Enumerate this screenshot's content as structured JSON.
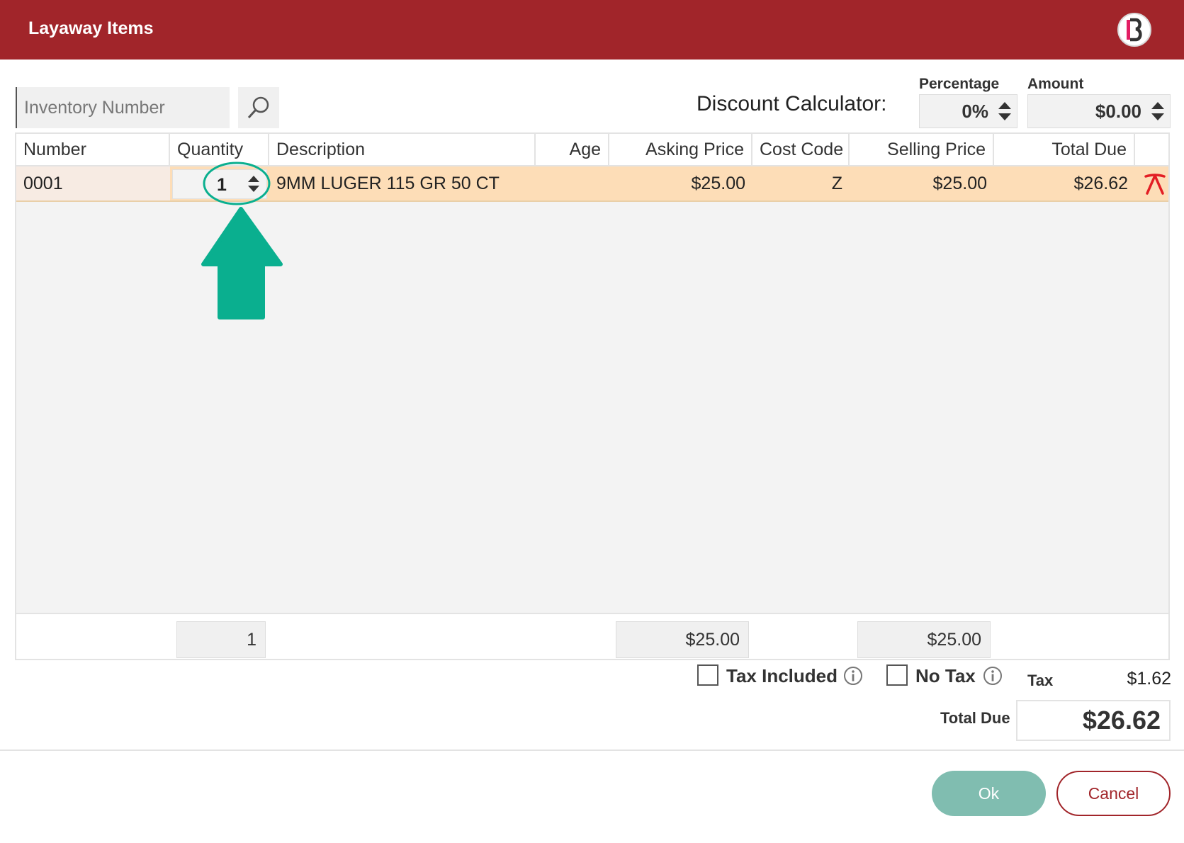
{
  "window": {
    "title": "Layaway Items"
  },
  "search": {
    "placeholder": "Inventory Number",
    "value": ""
  },
  "discount": {
    "label": "Discount Calculator:",
    "percentage_caption": "Percentage",
    "percentage_value": "0%",
    "amount_caption": "Amount",
    "amount_value": "$0.00"
  },
  "table": {
    "headers": [
      "Number",
      "Quantity",
      "Description",
      "Age",
      "Asking Price",
      "Cost Code",
      "Selling Price",
      "Total Due"
    ],
    "rows": [
      {
        "number": "0001",
        "quantity": "1",
        "description": "9MM LUGER 115 GR 50 CT",
        "age": "",
        "asking_price": "$25.00",
        "cost_code": "Z",
        "selling_price": "$25.00",
        "total_due": "$26.62"
      }
    ]
  },
  "totals": {
    "quantity": "1",
    "asking_price": "$25.00",
    "selling_price": "$25.00"
  },
  "tax": {
    "tax_included_label": "Tax Included",
    "no_tax_label": "No Tax",
    "tax_label": "Tax",
    "tax_value": "$1.62",
    "total_due_label": "Total Due",
    "total_due_value": "$26.62"
  },
  "buttons": {
    "ok": "Ok",
    "cancel": "Cancel"
  },
  "colors": {
    "title_bar": "#a1252a",
    "row_highlight": "#fdddb7",
    "ok_button": "#80bdb0",
    "annotation": "#0aaf8f",
    "remove_icon": "#e31e24"
  }
}
